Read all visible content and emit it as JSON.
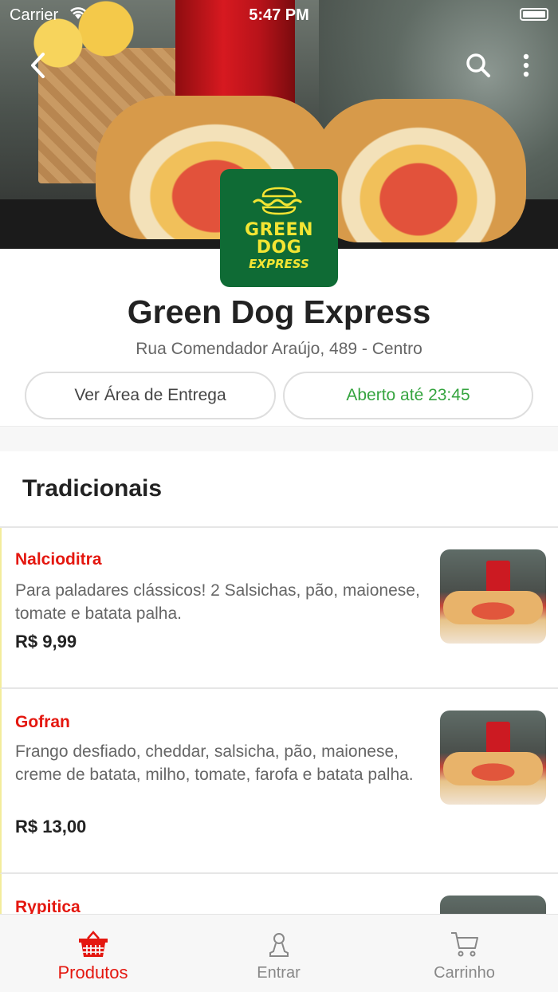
{
  "status_bar": {
    "carrier": "Carrier",
    "time": "5:47 PM"
  },
  "header": {
    "back_icon": "chevron-left-icon",
    "search_icon": "search-icon",
    "more_icon": "more-vertical-icon"
  },
  "store": {
    "logo_line1": "GREEN",
    "logo_line2": "DOG",
    "logo_line3": "EXPRESS",
    "name": "Green Dog Express",
    "address": "Rua Comendador Araújo, 489 - Centro",
    "delivery_area_label": "Ver Área de Entrega",
    "open_status": "Aberto até 23:45"
  },
  "colors": {
    "accent": "#e4170f",
    "open_green": "#35a43f",
    "logo_bg": "#0f6b35",
    "logo_yellow": "#f3e533"
  },
  "category": {
    "title": "Tradicionais"
  },
  "products": [
    {
      "name": "Nalcioditra",
      "description": "Para paladares clássicos! 2 Salsichas, pão, maionese, tomate e batata palha.",
      "price": "R$ 9,99"
    },
    {
      "name": "Gofran",
      "description": "Frango desfiado, cheddar, salsicha, pão, maionese, creme de batata, milho, tomate, farofa e batata palha.",
      "price": "R$ 13,00"
    },
    {
      "name": "Rypitica"
    }
  ],
  "tabbar": {
    "products_label": "Produtos",
    "login_label": "Entrar",
    "cart_label": "Carrinho",
    "products_icon": "basket-icon",
    "login_icon": "user-icon",
    "cart_icon": "cart-icon"
  }
}
